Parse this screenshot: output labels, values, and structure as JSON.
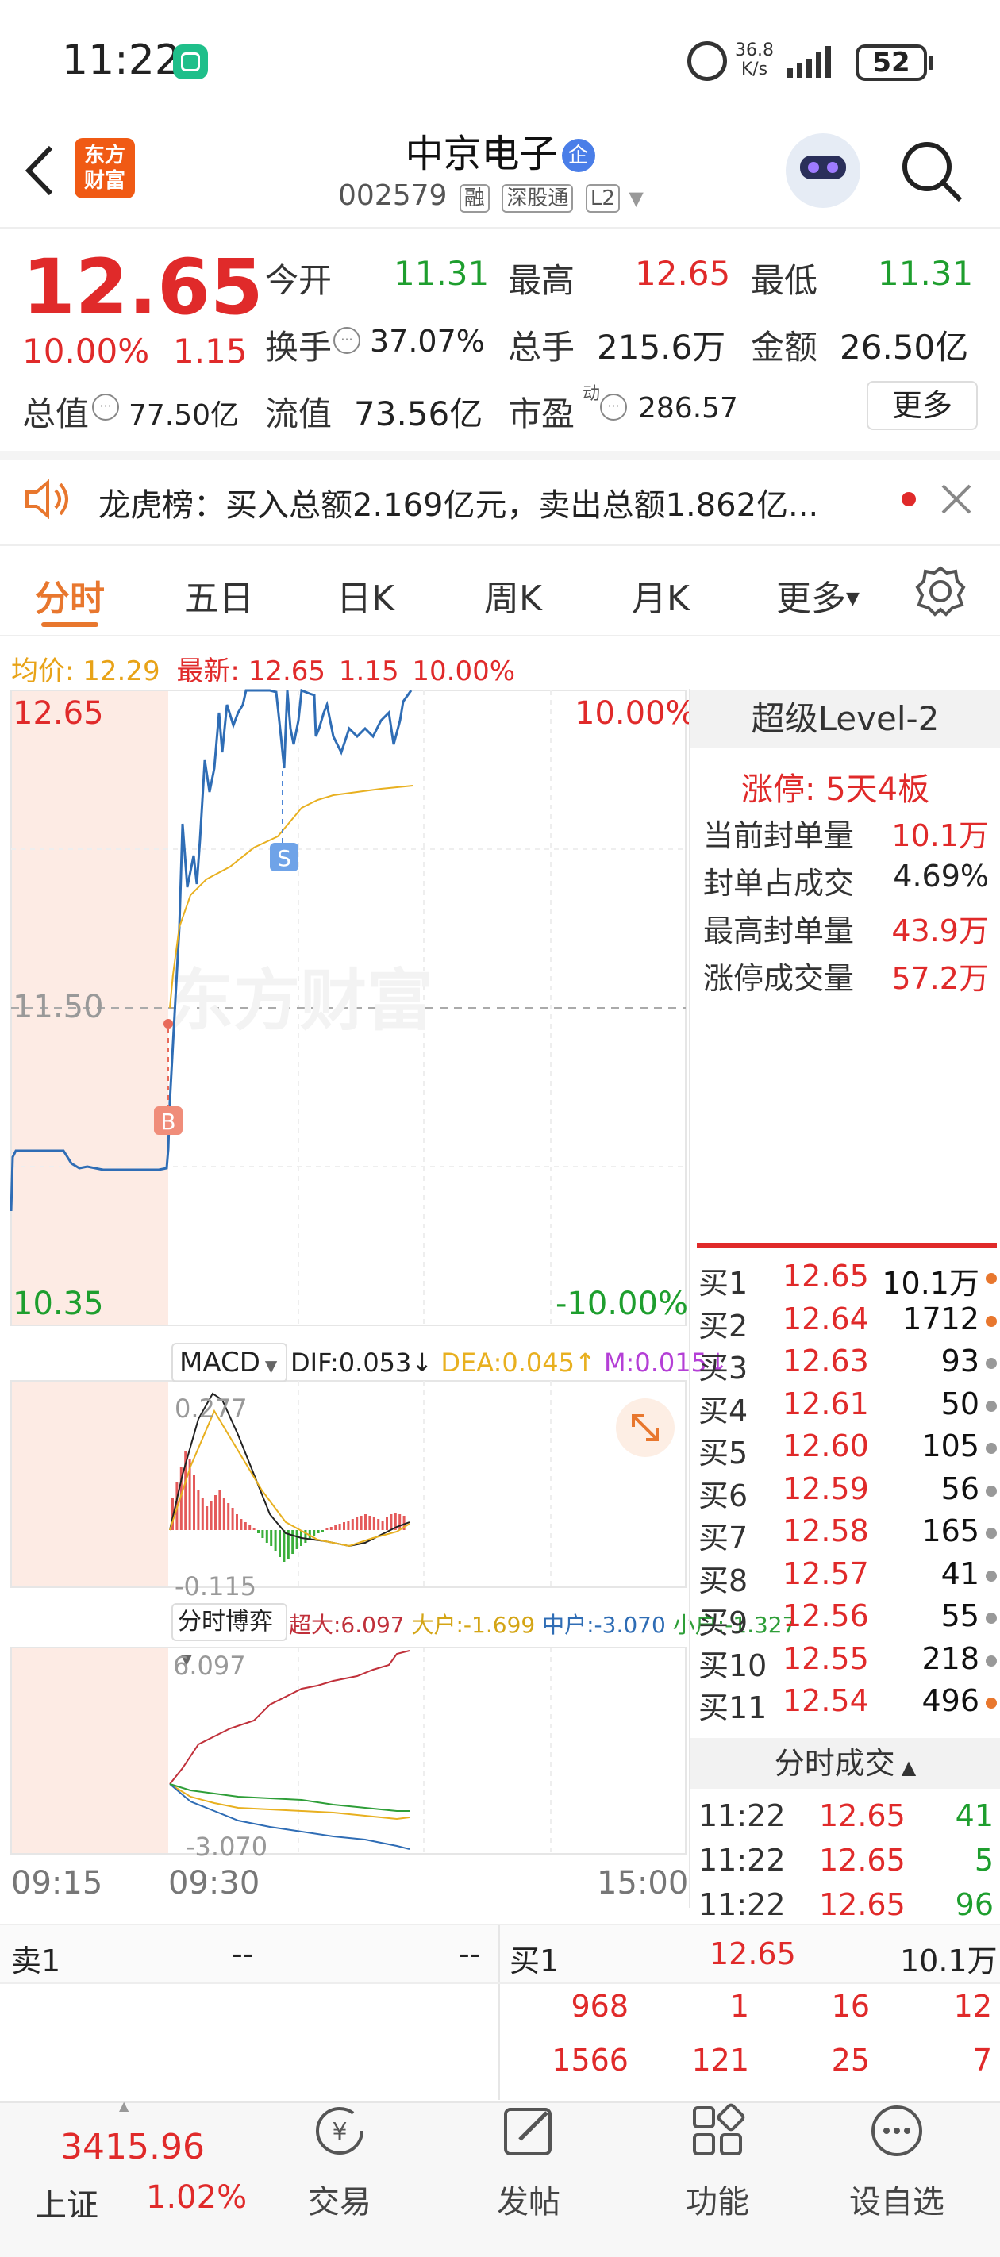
{
  "status_bar": {
    "time": "11:22",
    "net_speed_value": "36.8",
    "net_speed_unit": "K/s",
    "battery": "52"
  },
  "header": {
    "back_icon": "chevron-left-icon",
    "logo_line1": "东方",
    "logo_line2": "财富",
    "stock_name": "中京电子",
    "enterprise_badge": "企",
    "code": "002579",
    "tag_margin": "融",
    "tag_connect": "深股通",
    "tag_level": "L2"
  },
  "quote": {
    "price": "12.65",
    "change_pct": "10.00%",
    "change": "1.15",
    "open_label": "今开",
    "open": "11.31",
    "high_label": "最高",
    "high": "12.65",
    "low_label": "最低",
    "low": "11.31",
    "turnover_label": "换手",
    "turnover": "37.07%",
    "volume_label": "总手",
    "volume": "215.6万",
    "amount_label": "金额",
    "amount": "26.50亿",
    "mktcap_label": "总值",
    "mktcap": "77.50亿",
    "float_label": "流值",
    "float": "73.56亿",
    "pe_label": "市盈",
    "pe_sup": "动",
    "pe": "286.57",
    "more_button": "更多"
  },
  "notice": {
    "text": "龙虎榜：买入总额2.169亿元，卖出总额1.862亿..."
  },
  "tabs": [
    "分时",
    "五日",
    "日K",
    "周K",
    "月K",
    "更多"
  ],
  "chart_info": {
    "avg_label": "均价:",
    "avg": "12.29",
    "latest_label": "最新:",
    "latest": "12.65",
    "latest_change": "1.15",
    "latest_pct": "10.00%"
  },
  "chart_data": {
    "type": "line",
    "y_top_label": "12.65",
    "y_mid_label": "11.50",
    "y_bottom_label": "10.35",
    "pct_top_label": "10.00%",
    "pct_bottom_label": "-10.00%",
    "x_labels": [
      "09:15",
      "09:30",
      "15:00"
    ],
    "watermark": "东方财富",
    "markers": [
      "S",
      "B"
    ]
  },
  "macd": {
    "label": "MACD",
    "dif": "DIF:0.053",
    "dea": "DEA:0.045",
    "m": "M:0.015",
    "top": "0.277",
    "bottom": "-0.115"
  },
  "bout": {
    "label": "分时博弈",
    "super": "超大:6.097",
    "large": "大户:-1.699",
    "mid": "中户:-3.070",
    "small": "小户:-1.327",
    "top": "6.097",
    "bottom": "-3.070"
  },
  "level2": {
    "title": "超级Level-2",
    "limit_label": "涨停:",
    "limit_value": "5天4板",
    "rows": [
      {
        "k": "当前封单量",
        "v": "10.1万"
      },
      {
        "k": "封单占成交",
        "v": "4.69%"
      },
      {
        "k": "最高封单量",
        "v": "43.9万"
      },
      {
        "k": "涨停成交量",
        "v": "57.2万"
      }
    ]
  },
  "orderbook": [
    {
      "label": "买1",
      "price": "12.65",
      "vol": "10.1万",
      "dot": "#e8772e"
    },
    {
      "label": "买2",
      "price": "12.64",
      "vol": "1712",
      "dot": "#e8772e"
    },
    {
      "label": "买3",
      "price": "12.63",
      "vol": "93",
      "dot": "#999"
    },
    {
      "label": "买4",
      "price": "12.61",
      "vol": "50",
      "dot": "#999"
    },
    {
      "label": "买5",
      "price": "12.60",
      "vol": "105",
      "dot": "#999"
    },
    {
      "label": "买6",
      "price": "12.59",
      "vol": "56",
      "dot": "#999"
    },
    {
      "label": "买7",
      "price": "12.58",
      "vol": "165",
      "dot": "#999"
    },
    {
      "label": "买8",
      "price": "12.57",
      "vol": "41",
      "dot": "#999"
    },
    {
      "label": "买9",
      "price": "12.56",
      "vol": "55",
      "dot": "#999"
    },
    {
      "label": "买10",
      "price": "12.55",
      "vol": "218",
      "dot": "#999"
    },
    {
      "label": "买11",
      "price": "12.54",
      "vol": "496",
      "dot": "#e8772e"
    }
  ],
  "trades": {
    "title": "分时成交",
    "rows": [
      {
        "t": "11:22",
        "p": "12.65",
        "v": "41"
      },
      {
        "t": "11:22",
        "p": "12.65",
        "v": "5"
      },
      {
        "t": "11:22",
        "p": "12.65",
        "v": "96"
      }
    ]
  },
  "bottom_quote": {
    "sell1_label": "卖1",
    "sell1_price": "--",
    "sell1_vol": "--",
    "buy1_label": "买1",
    "buy1_price": "12.65",
    "buy1_vol": "10.1万",
    "queue_row1": [
      "968",
      "1",
      "16",
      "12"
    ],
    "queue_row2": [
      "1566",
      "121",
      "25",
      "7"
    ]
  },
  "bottom_nav": {
    "index_value": "3415.96",
    "index_name": "上证",
    "index_pct": "1.02%",
    "items": [
      "交易",
      "发帖",
      "功能",
      "设自选"
    ]
  }
}
